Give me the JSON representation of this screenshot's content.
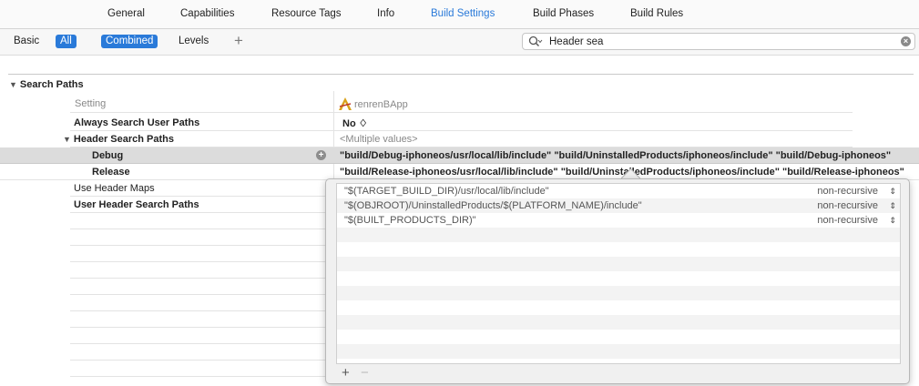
{
  "tabs": [
    {
      "label": "General"
    },
    {
      "label": "Capabilities"
    },
    {
      "label": "Resource Tags"
    },
    {
      "label": "Info"
    },
    {
      "label": "Build Settings",
      "active": true
    },
    {
      "label": "Build Phases"
    },
    {
      "label": "Build Rules"
    }
  ],
  "filter": {
    "basic": "Basic",
    "all": "All",
    "combined": "Combined",
    "levels": "Levels",
    "add": "+"
  },
  "search": {
    "value": "Header sea",
    "search_icon": "magnifier-icon",
    "clear_icon": "clear-circle-icon"
  },
  "section": {
    "title": "Search Paths",
    "header_setting": "Setting",
    "header_target": "renrenBApp",
    "rows": [
      {
        "name": "Always Search User Paths",
        "value": "No ♢"
      },
      {
        "name": "Header Search Paths",
        "value": "<Multiple values>"
      },
      {
        "name": "Debug",
        "value": "\"build/Debug-iphoneos/usr/local/lib/include\" \"build/UninstalledProducts/iphoneos/include\" \"build/Debug-iphoneos\""
      },
      {
        "name": "Release",
        "value": "\"build/Release-iphoneos/usr/local/lib/include\" \"build/UninstalledProducts/iphoneos/include\" \"build/Release-iphoneos\""
      },
      {
        "name": "Use Header Maps",
        "value": ""
      },
      {
        "name": "User Header Search Paths",
        "value": ""
      }
    ]
  },
  "popover": {
    "items": [
      {
        "path": "\"$(TARGET_BUILD_DIR)/usr/local/lib/include\"",
        "mode": "non-recursive"
      },
      {
        "path": "\"$(OBJROOT)/UninstalledProducts/$(PLATFORM_NAME)/include\"",
        "mode": "non-recursive"
      },
      {
        "path": "\"$(BUILT_PRODUCTS_DIR)\"",
        "mode": "non-recursive"
      }
    ],
    "add": "+",
    "remove": "−"
  },
  "colors": {
    "accent": "#2a7ad9",
    "highlight_row": "#dcdcdc"
  }
}
